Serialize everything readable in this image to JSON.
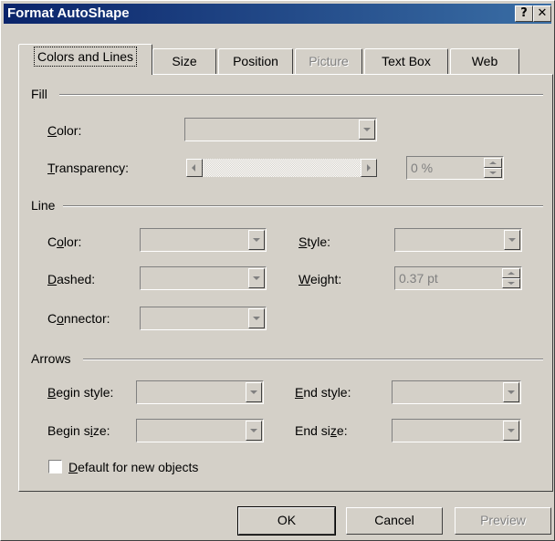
{
  "window": {
    "title": "Format AutoShape",
    "help_button": "?",
    "close_button": "✕"
  },
  "tabs": [
    {
      "label": "Colors and Lines",
      "active": true
    },
    {
      "label": "Size"
    },
    {
      "label": "Position"
    },
    {
      "label": "Picture",
      "disabled": true
    },
    {
      "label": "Text Box"
    },
    {
      "label": "Web"
    }
  ],
  "fill": {
    "group_label": "Fill",
    "color_label": [
      "",
      "C",
      "olor:"
    ],
    "transparency_label": [
      "",
      "T",
      "ransparency:"
    ],
    "transparency_value": "0 %"
  },
  "line": {
    "group_label": "Line",
    "color_label": [
      "C",
      "o",
      "lor:"
    ],
    "dashed_label": [
      "",
      "D",
      "ashed:"
    ],
    "connector_label": [
      "C",
      "o",
      "nnector:"
    ],
    "style_label": [
      "",
      "S",
      "tyle:"
    ],
    "weight_label": [
      "",
      "W",
      "eight:"
    ],
    "weight_value": "0.37 pt"
  },
  "arrows": {
    "group_label": "Arrows",
    "begin_style_label": [
      "",
      "B",
      "egin style:"
    ],
    "begin_size_label": [
      "Begin s",
      "i",
      "ze:"
    ],
    "end_style_label": [
      "",
      "E",
      "nd style:"
    ],
    "end_size_label": [
      "End si",
      "z",
      "e:"
    ]
  },
  "default_checkbox": {
    "label": [
      "",
      "D",
      "efault for new objects"
    ],
    "checked": false
  },
  "buttons": {
    "ok": "OK",
    "cancel": "Cancel",
    "preview": "Preview"
  }
}
